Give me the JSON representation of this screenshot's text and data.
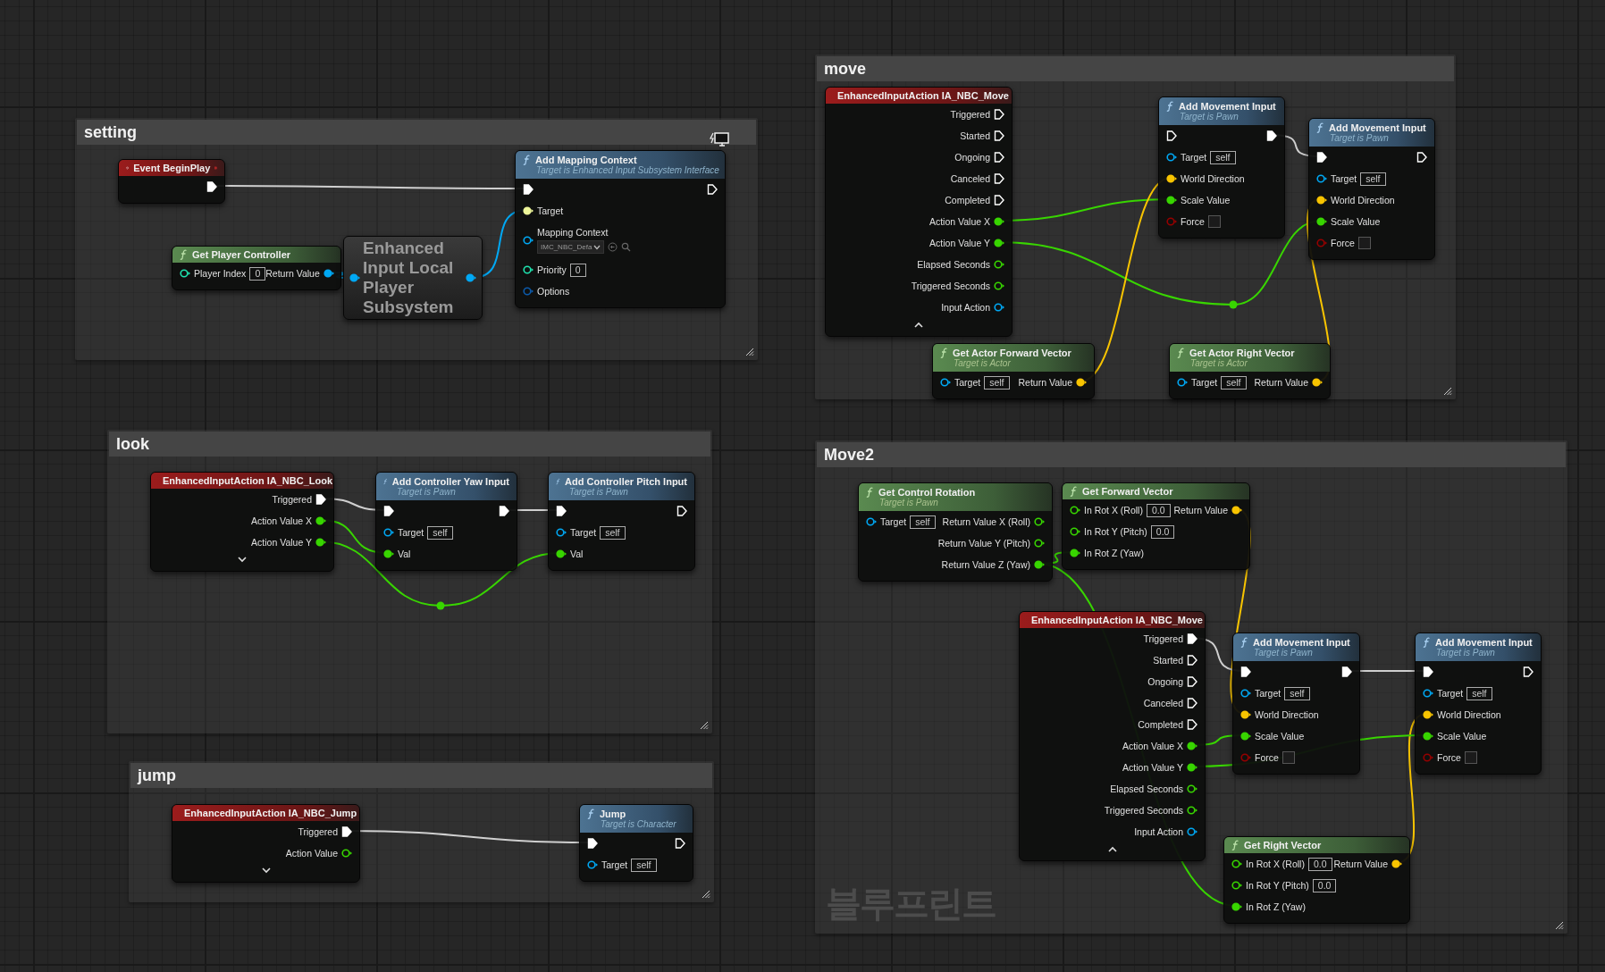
{
  "comments": [
    {
      "title": "setting",
      "nodes": [
        {
          "kind": "event",
          "title": "Event BeginPlay",
          "delegate": true,
          "rows": [
            {
              "out": {
                "kind": "exec",
                "connected": true
              }
            }
          ]
        },
        {
          "kind": "pure",
          "title": "Get Player Controller",
          "rows": [
            {
              "in": {
                "label": "Player Index",
                "kind": "int",
                "connected": false,
                "value": "0"
              },
              "out": {
                "label": "Return Value",
                "kind": "object",
                "connected": true
              }
            }
          ]
        },
        {
          "kind": "compact",
          "title": "Enhanced Input Local Player Subsystem",
          "rows": [
            {
              "in": {
                "kind": "object",
                "connected": true
              },
              "out": {
                "kind": "object",
                "connected": true
              }
            }
          ]
        },
        {
          "kind": "function",
          "title": "Add Mapping Context",
          "subtitle": "Target is Enhanced Input Subsystem Interface",
          "client_only": true,
          "rows": [
            {
              "in": {
                "kind": "exec",
                "connected": true
              },
              "out": {
                "kind": "exec",
                "connected": false
              }
            },
            {
              "in": {
                "label": "Target",
                "kind": "interface",
                "connected": true
              }
            },
            {
              "in": {
                "label": "Mapping Context",
                "kind": "object",
                "connected": false,
                "dropdown": "IMC_NBC_Defa"
              }
            },
            {
              "in": {
                "label": "Priority",
                "kind": "int",
                "connected": false,
                "value": "0"
              }
            },
            {
              "in": {
                "label": "Options",
                "kind": "struct",
                "connected": false
              }
            }
          ]
        }
      ]
    },
    {
      "title": "move",
      "nodes": [
        {
          "kind": "event",
          "title": "EnhancedInputAction IA_NBC_Move",
          "expanded": true,
          "rows": [
            {
              "out": {
                "label": "Triggered",
                "kind": "exec",
                "connected": false
              }
            },
            {
              "out": {
                "label": "Started",
                "kind": "exec",
                "connected": false
              }
            },
            {
              "out": {
                "label": "Ongoing",
                "kind": "exec",
                "connected": false
              }
            },
            {
              "out": {
                "label": "Canceled",
                "kind": "exec",
                "connected": false
              }
            },
            {
              "out": {
                "label": "Completed",
                "kind": "exec",
                "connected": false
              }
            },
            {
              "out": {
                "label": "Action Value X",
                "kind": "float",
                "connected": true
              }
            },
            {
              "out": {
                "label": "Action Value Y",
                "kind": "float",
                "connected": true
              }
            },
            {
              "out": {
                "label": "Elapsed Seconds",
                "kind": "float",
                "connected": false
              }
            },
            {
              "out": {
                "label": "Triggered Seconds",
                "kind": "float",
                "connected": false
              }
            },
            {
              "out": {
                "label": "Input Action",
                "kind": "object",
                "connected": false
              }
            }
          ]
        },
        {
          "kind": "function",
          "title": "Add Movement Input",
          "subtitle": "Target is Pawn",
          "rows": [
            {
              "in": {
                "kind": "exec",
                "connected": false
              },
              "out": {
                "kind": "exec",
                "connected": true
              }
            },
            {
              "in": {
                "label": "Target",
                "kind": "object",
                "connected": false,
                "value": "self"
              }
            },
            {
              "in": {
                "label": "World Direction",
                "kind": "vector",
                "connected": true
              }
            },
            {
              "in": {
                "label": "Scale Value",
                "kind": "float",
                "connected": true
              }
            },
            {
              "in": {
                "label": "Force",
                "kind": "bool",
                "connected": false,
                "checked": false
              }
            }
          ]
        },
        {
          "kind": "function",
          "title": "Add Movement Input",
          "subtitle": "Target is Pawn",
          "rows": [
            {
              "in": {
                "kind": "exec",
                "connected": true
              },
              "out": {
                "kind": "exec",
                "connected": false
              }
            },
            {
              "in": {
                "label": "Target",
                "kind": "object",
                "connected": false,
                "value": "self"
              }
            },
            {
              "in": {
                "label": "World Direction",
                "kind": "vector",
                "connected": true
              }
            },
            {
              "in": {
                "label": "Scale Value",
                "kind": "float",
                "connected": true
              }
            },
            {
              "in": {
                "label": "Force",
                "kind": "bool",
                "connected": false,
                "checked": false
              }
            }
          ]
        },
        {
          "kind": "pure",
          "title": "Get Actor Forward Vector",
          "subtitle": "Target is Actor",
          "rows": [
            {
              "in": {
                "label": "Target",
                "kind": "object",
                "connected": false,
                "value": "self"
              },
              "out": {
                "label": "Return Value",
                "kind": "vector",
                "connected": true
              }
            }
          ]
        },
        {
          "kind": "pure",
          "title": "Get Actor Right Vector",
          "subtitle": "Target is Actor",
          "rows": [
            {
              "in": {
                "label": "Target",
                "kind": "object",
                "connected": false,
                "value": "self"
              },
              "out": {
                "label": "Return Value",
                "kind": "vector",
                "connected": true
              }
            }
          ]
        }
      ]
    },
    {
      "title": "look",
      "nodes": [
        {
          "kind": "event",
          "title": "EnhancedInputAction IA_NBC_Look",
          "expanded": false,
          "rows": [
            {
              "out": {
                "label": "Triggered",
                "kind": "exec",
                "connected": true
              }
            },
            {
              "out": {
                "label": "Action Value X",
                "kind": "float",
                "connected": true
              }
            },
            {
              "out": {
                "label": "Action Value Y",
                "kind": "float",
                "connected": true
              }
            }
          ]
        },
        {
          "kind": "function",
          "title": "Add Controller Yaw Input",
          "subtitle": "Target is Pawn",
          "rows": [
            {
              "in": {
                "kind": "exec",
                "connected": true
              },
              "out": {
                "kind": "exec",
                "connected": true
              }
            },
            {
              "in": {
                "label": "Target",
                "kind": "object",
                "connected": false,
                "value": "self"
              }
            },
            {
              "in": {
                "label": "Val",
                "kind": "float",
                "connected": true
              }
            }
          ]
        },
        {
          "kind": "function",
          "title": "Add Controller Pitch Input",
          "subtitle": "Target is Pawn",
          "rows": [
            {
              "in": {
                "kind": "exec",
                "connected": true
              },
              "out": {
                "kind": "exec",
                "connected": false
              }
            },
            {
              "in": {
                "label": "Target",
                "kind": "object",
                "connected": false,
                "value": "self"
              }
            },
            {
              "in": {
                "label": "Val",
                "kind": "float",
                "connected": true
              }
            }
          ]
        }
      ]
    },
    {
      "title": "jump",
      "nodes": [
        {
          "kind": "event",
          "title": "EnhancedInputAction IA_NBC_Jump",
          "expanded": false,
          "rows": [
            {
              "out": {
                "label": "Triggered",
                "kind": "exec",
                "connected": true
              }
            },
            {
              "out": {
                "label": "Action Value",
                "kind": "float",
                "connected": false
              }
            }
          ]
        },
        {
          "kind": "function",
          "title": "Jump",
          "subtitle": "Target is Character",
          "rows": [
            {
              "in": {
                "kind": "exec",
                "connected": true
              },
              "out": {
                "kind": "exec",
                "connected": false
              }
            },
            {
              "in": {
                "label": "Target",
                "kind": "object",
                "connected": false,
                "value": "self"
              }
            }
          ]
        }
      ]
    },
    {
      "title": "Move2",
      "nodes": [
        {
          "kind": "pure",
          "title": "Get Control Rotation",
          "subtitle": "Target is Pawn",
          "rows": [
            {
              "in": {
                "label": "Target",
                "kind": "object",
                "connected": false,
                "value": "self"
              },
              "out": {
                "label": "Return Value X (Roll)",
                "kind": "float",
                "connected": false
              }
            },
            {
              "out": {
                "label": "Return Value Y (Pitch)",
                "kind": "float",
                "connected": false
              }
            },
            {
              "out": {
                "label": "Return Value Z (Yaw)",
                "kind": "float",
                "connected": true
              }
            }
          ]
        },
        {
          "kind": "pure",
          "title": "Get Forward Vector",
          "rows": [
            {
              "in": {
                "label": "In Rot X (Roll)",
                "kind": "float",
                "connected": false,
                "value": "0.0"
              },
              "out": {
                "label": "Return Value",
                "kind": "vector",
                "connected": true
              }
            },
            {
              "in": {
                "label": "In Rot Y (Pitch)",
                "kind": "float",
                "connected": false,
                "value": "0.0"
              }
            },
            {
              "in": {
                "label": "In Rot Z (Yaw)",
                "kind": "float",
                "connected": true
              }
            }
          ]
        },
        {
          "kind": "event",
          "title": "EnhancedInputAction IA_NBC_Move",
          "expanded": true,
          "rows": [
            {
              "out": {
                "label": "Triggered",
                "kind": "exec",
                "connected": true
              }
            },
            {
              "out": {
                "label": "Started",
                "kind": "exec",
                "connected": false
              }
            },
            {
              "out": {
                "label": "Ongoing",
                "kind": "exec",
                "connected": false
              }
            },
            {
              "out": {
                "label": "Canceled",
                "kind": "exec",
                "connected": false
              }
            },
            {
              "out": {
                "label": "Completed",
                "kind": "exec",
                "connected": false
              }
            },
            {
              "out": {
                "label": "Action Value X",
                "kind": "float",
                "connected": true
              }
            },
            {
              "out": {
                "label": "Action Value Y",
                "kind": "float",
                "connected": true
              }
            },
            {
              "out": {
                "label": "Elapsed Seconds",
                "kind": "float",
                "connected": false
              }
            },
            {
              "out": {
                "label": "Triggered Seconds",
                "kind": "float",
                "connected": false
              }
            },
            {
              "out": {
                "label": "Input Action",
                "kind": "object",
                "connected": false
              }
            }
          ]
        },
        {
          "kind": "function",
          "title": "Add Movement Input",
          "subtitle": "Target is Pawn",
          "rows": [
            {
              "in": {
                "kind": "exec",
                "connected": true
              },
              "out": {
                "kind": "exec",
                "connected": true
              }
            },
            {
              "in": {
                "label": "Target",
                "kind": "object",
                "connected": false,
                "value": "self"
              }
            },
            {
              "in": {
                "label": "World Direction",
                "kind": "vector",
                "connected": true
              }
            },
            {
              "in": {
                "label": "Scale Value",
                "kind": "float",
                "connected": true
              }
            },
            {
              "in": {
                "label": "Force",
                "kind": "bool",
                "connected": false,
                "checked": false
              }
            }
          ]
        },
        {
          "kind": "function",
          "title": "Add Movement Input",
          "subtitle": "Target is Pawn",
          "rows": [
            {
              "in": {
                "kind": "exec",
                "connected": true
              },
              "out": {
                "kind": "exec",
                "connected": false
              }
            },
            {
              "in": {
                "label": "Target",
                "kind": "object",
                "connected": false,
                "value": "self"
              }
            },
            {
              "in": {
                "label": "World Direction",
                "kind": "vector",
                "connected": true
              }
            },
            {
              "in": {
                "label": "Scale Value",
                "kind": "float",
                "connected": true
              }
            },
            {
              "in": {
                "label": "Force",
                "kind": "bool",
                "connected": false,
                "checked": false
              }
            }
          ]
        },
        {
          "kind": "pure",
          "title": "Get Right Vector",
          "rows": [
            {
              "in": {
                "label": "In Rot X (Roll)",
                "kind": "float",
                "connected": false,
                "value": "0.0"
              },
              "out": {
                "label": "Return Value",
                "kind": "vector",
                "connected": true
              }
            },
            {
              "in": {
                "label": "In Rot Y (Pitch)",
                "kind": "float",
                "connected": false,
                "value": "0.0"
              }
            },
            {
              "in": {
                "label": "In Rot Z (Yaw)",
                "kind": "float",
                "connected": true
              }
            }
          ]
        }
      ]
    }
  ],
  "watermark": "블루프린트"
}
